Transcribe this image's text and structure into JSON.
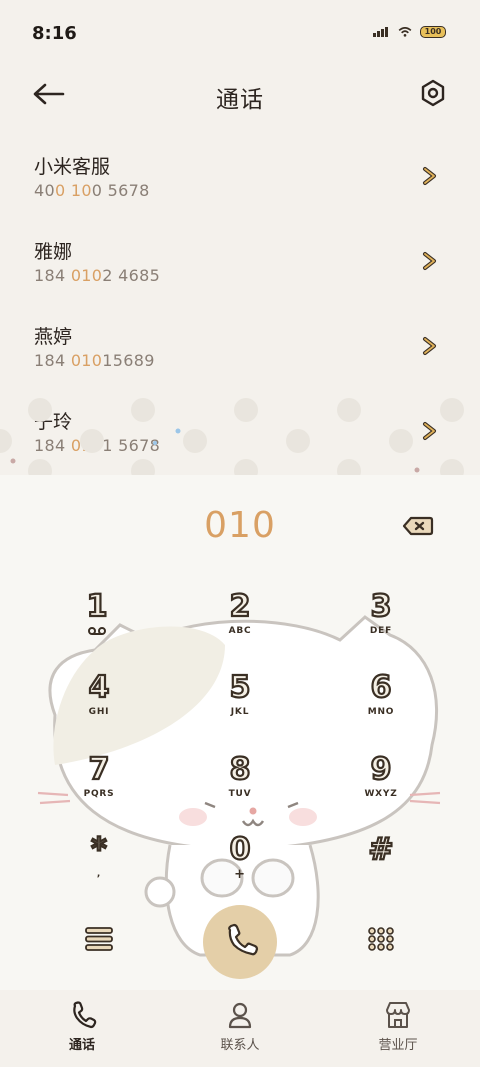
{
  "status": {
    "time": "8:16",
    "battery": "100"
  },
  "header": {
    "title": "通话"
  },
  "results": [
    {
      "name": "小米客服",
      "number_parts": [
        "40",
        "0 10",
        "0 5678"
      ]
    },
    {
      "name": "雅娜",
      "number_parts": [
        "184 ",
        "010",
        "2 4685"
      ]
    },
    {
      "name": "燕婷",
      "number_parts": [
        "184 ",
        "010",
        "15689"
      ]
    },
    {
      "name": "子玲",
      "number_parts": [
        "184 ",
        "010",
        "1 5678"
      ]
    }
  ],
  "dialpad": {
    "dialed": "010",
    "keys": [
      {
        "digit": "1",
        "letters": ""
      },
      {
        "digit": "2",
        "letters": "ABC"
      },
      {
        "digit": "3",
        "letters": "DEF"
      },
      {
        "digit": "4",
        "letters": "GHI"
      },
      {
        "digit": "5",
        "letters": "JKL"
      },
      {
        "digit": "6",
        "letters": "MNO"
      },
      {
        "digit": "7",
        "letters": "PQRS"
      },
      {
        "digit": "8",
        "letters": "TUV"
      },
      {
        "digit": "9",
        "letters": "WXYZ"
      },
      {
        "digit": "*",
        "letters": ","
      },
      {
        "digit": "0",
        "letters": "+"
      },
      {
        "digit": "#",
        "letters": ""
      }
    ]
  },
  "nav": {
    "calls": "通话",
    "contacts": "联系人",
    "business": "营业厅"
  },
  "colors": {
    "accent": "#d9a064",
    "call_button": "#e4cfa8",
    "ink": "#3a2f24"
  }
}
